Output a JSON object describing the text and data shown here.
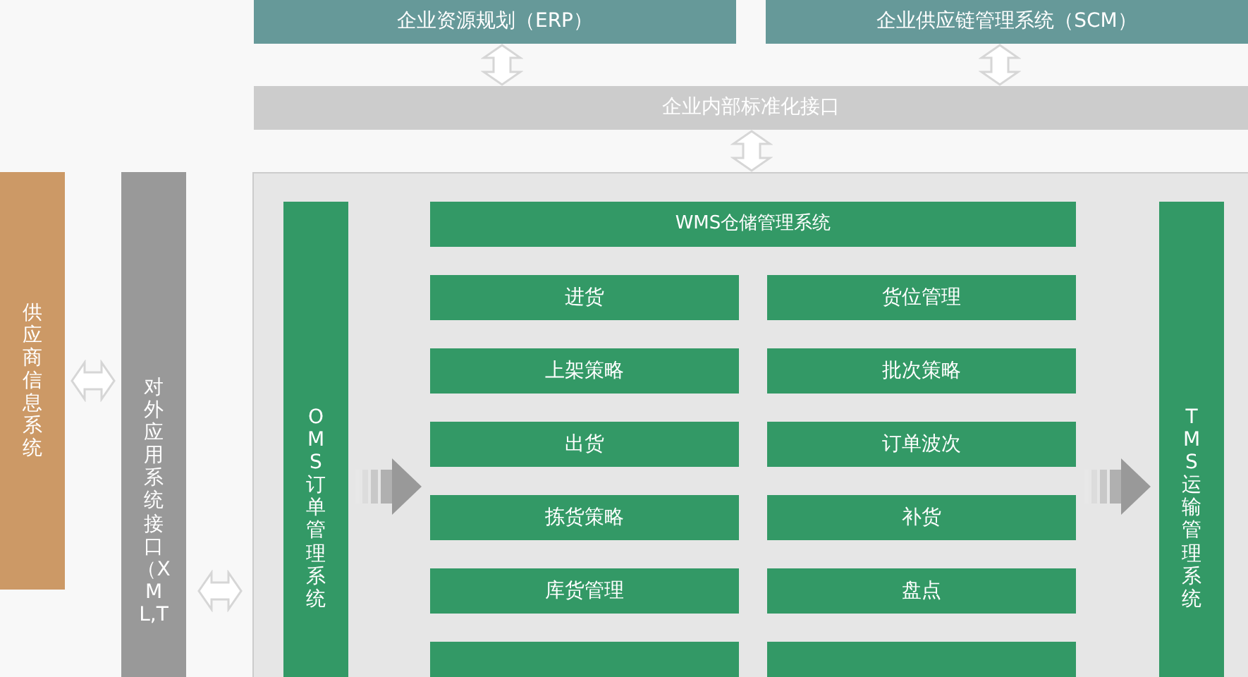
{
  "top_systems": [
    {
      "label": "企业资源规划（ERP）"
    },
    {
      "label": "企业供应链管理系统（SCM）"
    }
  ],
  "internal_interface": {
    "label": "企业内部标准化接口"
  },
  "supplier_system": {
    "label": "供应商信息系统"
  },
  "external_interface": {
    "label": "对外应用系统接口（XML,T"
  },
  "oms": {
    "label": "OMS订单管理系统"
  },
  "wms": {
    "title": "WMS仓储管理系统",
    "modules": [
      "进货",
      "货位管理",
      "上架策略",
      "批次策略",
      "出货",
      "订单波次",
      "拣货策略",
      "补货",
      "库货管理",
      "盘点"
    ]
  },
  "tms": {
    "label": "TMS运输管理系统"
  }
}
